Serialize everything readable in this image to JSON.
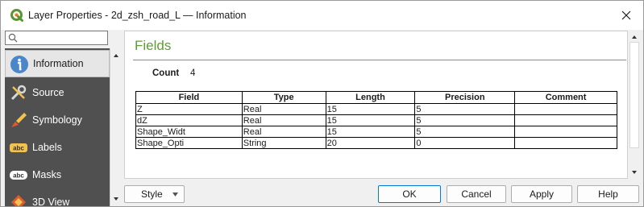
{
  "window": {
    "title": "Layer Properties - 2d_zsh_road_L — Information",
    "app_icon": "qgis-logo-icon",
    "close_icon": "close-icon"
  },
  "sidebar": {
    "search": {
      "placeholder": "",
      "value": "",
      "icon": "search-icon"
    },
    "items": [
      {
        "label": "Information",
        "icon": "info-icon",
        "active": true
      },
      {
        "label": "Source",
        "icon": "source-tools-icon",
        "active": false
      },
      {
        "label": "Symbology",
        "icon": "symbology-brush-icon",
        "active": false
      },
      {
        "label": "Labels",
        "icon": "abc-labels-icon",
        "active": false
      },
      {
        "label": "Masks",
        "icon": "abc-masks-icon",
        "active": false
      },
      {
        "label": "3D View",
        "icon": "3d-view-icon",
        "active": false
      }
    ]
  },
  "main": {
    "section_title": "Fields",
    "count_label": "Count",
    "count_value": "4",
    "table": {
      "headers": [
        "Field",
        "Type",
        "Length",
        "Precision",
        "Comment"
      ],
      "rows": [
        [
          "Z",
          "Real",
          "15",
          "5",
          ""
        ],
        [
          "dZ",
          "Real",
          "15",
          "5",
          ""
        ],
        [
          "Shape_Widt",
          "Real",
          "15",
          "5",
          ""
        ],
        [
          "Shape_Opti",
          "String",
          "20",
          "0",
          ""
        ]
      ]
    }
  },
  "buttons": {
    "style": "Style",
    "ok": "OK",
    "cancel": "Cancel",
    "apply": "Apply",
    "help": "Help"
  },
  "colors": {
    "accent_green": "#5c9e33",
    "sidebar_bg": "#505050",
    "ok_border": "#0078d7"
  }
}
